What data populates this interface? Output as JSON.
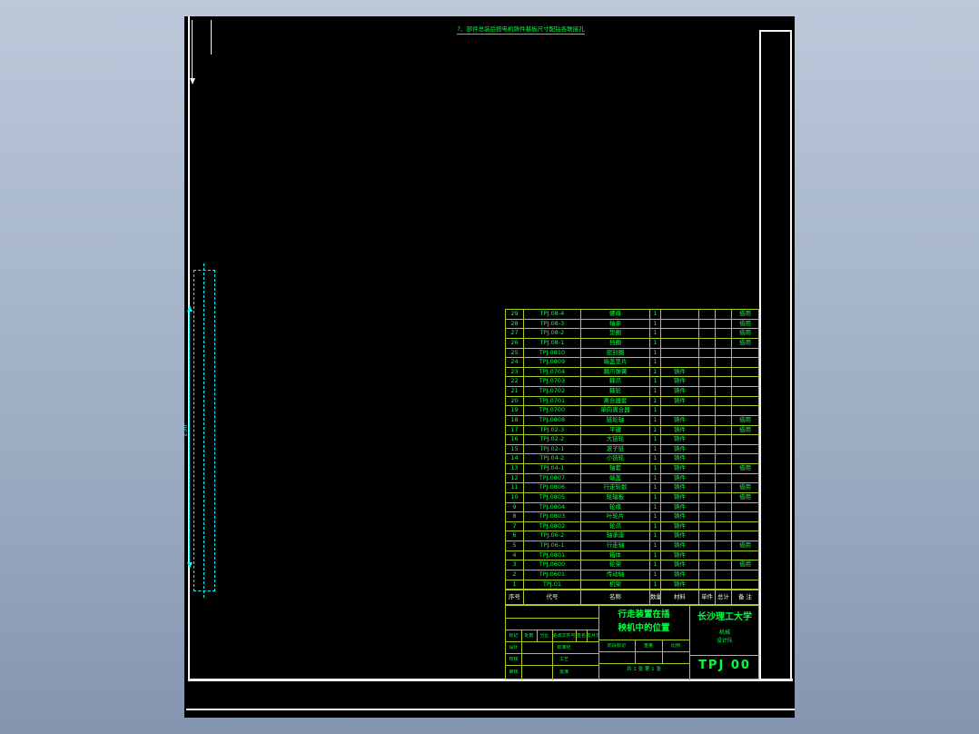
{
  "note": {
    "text": "7、部件总装后按电机铸件基板尺寸配钻各联接孔"
  },
  "dimension": {
    "label": "250"
  },
  "bom": {
    "headers": [
      "序号",
      "代号",
      "名称",
      "数量",
      "材料",
      "单件",
      "总计",
      "备 注"
    ],
    "rows": [
      {
        "no": "29",
        "code": "TPJ.08-4",
        "name": "螺母",
        "qty": "1",
        "material": "",
        "unit": "",
        "total": "",
        "remark": "借用"
      },
      {
        "no": "28",
        "code": "TPJ.08-3",
        "name": "轴承",
        "qty": "1",
        "material": "",
        "unit": "",
        "total": "",
        "remark": "借用"
      },
      {
        "no": "27",
        "code": "TPJ.08-2",
        "name": "垫圈",
        "qty": "1",
        "material": "",
        "unit": "",
        "total": "",
        "remark": "借用"
      },
      {
        "no": "26",
        "code": "TPJ.08-1",
        "name": "挡圈",
        "qty": "1",
        "material": "",
        "unit": "",
        "total": "",
        "remark": "借用"
      },
      {
        "no": "25",
        "code": "TPJ.0810",
        "name": "密封圈",
        "qty": "1",
        "material": "",
        "unit": "",
        "total": "",
        "remark": ""
      },
      {
        "no": "24",
        "code": "TPJ.0809",
        "name": "端盖垫片",
        "qty": "1",
        "material": "",
        "unit": "",
        "total": "",
        "remark": ""
      },
      {
        "no": "23",
        "code": "TPJ.0704",
        "name": "棘爪弹簧",
        "qty": "1",
        "material": "铸件",
        "unit": "",
        "total": "",
        "remark": ""
      },
      {
        "no": "22",
        "code": "TPJ.0703",
        "name": "棘爪",
        "qty": "1",
        "material": "铸件",
        "unit": "",
        "total": "",
        "remark": ""
      },
      {
        "no": "21",
        "code": "TPJ.0702",
        "name": "棘轮",
        "qty": "1",
        "material": "铸件",
        "unit": "",
        "total": "",
        "remark": ""
      },
      {
        "no": "20",
        "code": "TPJ.0701",
        "name": "离合器套",
        "qty": "1",
        "material": "铸件",
        "unit": "",
        "total": "",
        "remark": ""
      },
      {
        "no": "19",
        "code": "TPJ.0700",
        "name": "单向离合器",
        "qty": "1",
        "material": "",
        "unit": "",
        "total": "",
        "remark": ""
      },
      {
        "no": "18",
        "code": "TPJ.0808",
        "name": "链轮轴",
        "qty": "1",
        "material": "铸件",
        "unit": "",
        "total": "",
        "remark": "借用"
      },
      {
        "no": "17",
        "code": "TPJ.02-3",
        "name": "平键",
        "qty": "1",
        "material": "铸件",
        "unit": "",
        "total": "",
        "remark": "借用"
      },
      {
        "no": "16",
        "code": "TPJ.02-2",
        "name": "大链轮",
        "qty": "1",
        "material": "铸件",
        "unit": "",
        "total": "",
        "remark": ""
      },
      {
        "no": "15",
        "code": "TPJ.02-1",
        "name": "滚子链",
        "qty": "1",
        "material": "铸件",
        "unit": "",
        "total": "",
        "remark": ""
      },
      {
        "no": "14",
        "code": "TPJ.04-2",
        "name": "小链轮",
        "qty": "1",
        "material": "铸件",
        "unit": "",
        "total": "",
        "remark": ""
      },
      {
        "no": "13",
        "code": "TPJ.04-1",
        "name": "轴套",
        "qty": "1",
        "material": "铸件",
        "unit": "",
        "total": "",
        "remark": "借用"
      },
      {
        "no": "12",
        "code": "TPJ.0807",
        "name": "端盖",
        "qty": "1",
        "material": "铸件",
        "unit": "",
        "total": "",
        "remark": ""
      },
      {
        "no": "11",
        "code": "TPJ.0806",
        "name": "行走轮毂",
        "qty": "1",
        "material": "铸件",
        "unit": "",
        "total": "",
        "remark": "借用"
      },
      {
        "no": "10",
        "code": "TPJ.0805",
        "name": "轮辐板",
        "qty": "1",
        "material": "铸件",
        "unit": "",
        "total": "",
        "remark": "借用"
      },
      {
        "no": "9",
        "code": "TPJ.0804",
        "name": "轮缘",
        "qty": "1",
        "material": "铸件",
        "unit": "",
        "total": "",
        "remark": ""
      },
      {
        "no": "8",
        "code": "TPJ.0803",
        "name": "叶轮片",
        "qty": "1",
        "material": "铸件",
        "unit": "",
        "total": "",
        "remark": ""
      },
      {
        "no": "7",
        "code": "TPJ.0802",
        "name": "轮爪",
        "qty": "1",
        "material": "铸件",
        "unit": "",
        "total": "",
        "remark": ""
      },
      {
        "no": "6",
        "code": "TPJ.06-2",
        "name": "轴承座",
        "qty": "1",
        "material": "铸件",
        "unit": "",
        "total": "",
        "remark": ""
      },
      {
        "no": "5",
        "code": "TPJ.06-1",
        "name": "行走轴",
        "qty": "1",
        "material": "铸件",
        "unit": "",
        "total": "",
        "remark": "借用"
      },
      {
        "no": "4",
        "code": "TPJ.0801",
        "name": "箱体",
        "qty": "1",
        "material": "铸件",
        "unit": "",
        "total": "",
        "remark": ""
      },
      {
        "no": "3",
        "code": "TPJ.0600",
        "name": "轮架",
        "qty": "1",
        "material": "铸件",
        "unit": "",
        "total": "",
        "remark": "借用"
      },
      {
        "no": "2",
        "code": "TPJ.0601",
        "name": "传动轴",
        "qty": "1",
        "material": "铸件",
        "unit": "",
        "total": "",
        "remark": ""
      },
      {
        "no": "1",
        "code": "TPJ.01",
        "name": "机架",
        "qty": "1",
        "material": "铸件",
        "unit": "",
        "total": "",
        "remark": ""
      }
    ]
  },
  "title_block": {
    "title_line1": "行走装置在插",
    "title_line2": "秧机中的位置",
    "university": "长沙理工大学",
    "dept_line1": "机械",
    "dept_line2": "设计队",
    "drawing_no": "TPJ 00",
    "sheet_info": "共 1 张 第 1 张",
    "labels": {
      "mark": "标记",
      "count": "处数",
      "zone": "分区",
      "change_doc": "更改文件号",
      "sign": "签名",
      "date": "年月日",
      "design": "设计",
      "standardize": "标准化",
      "check": "校核",
      "process": "工艺",
      "review": "审核",
      "approve": "批准",
      "stage_mark": "阶段标记",
      "weight": "重量",
      "scale": "比例"
    }
  },
  "colors": {
    "line_green": "#a8cc22",
    "text_green": "#00ff41",
    "cyan": "#00ffff",
    "frame_white": "#f5f5f5",
    "canvas_black": "#000000"
  }
}
